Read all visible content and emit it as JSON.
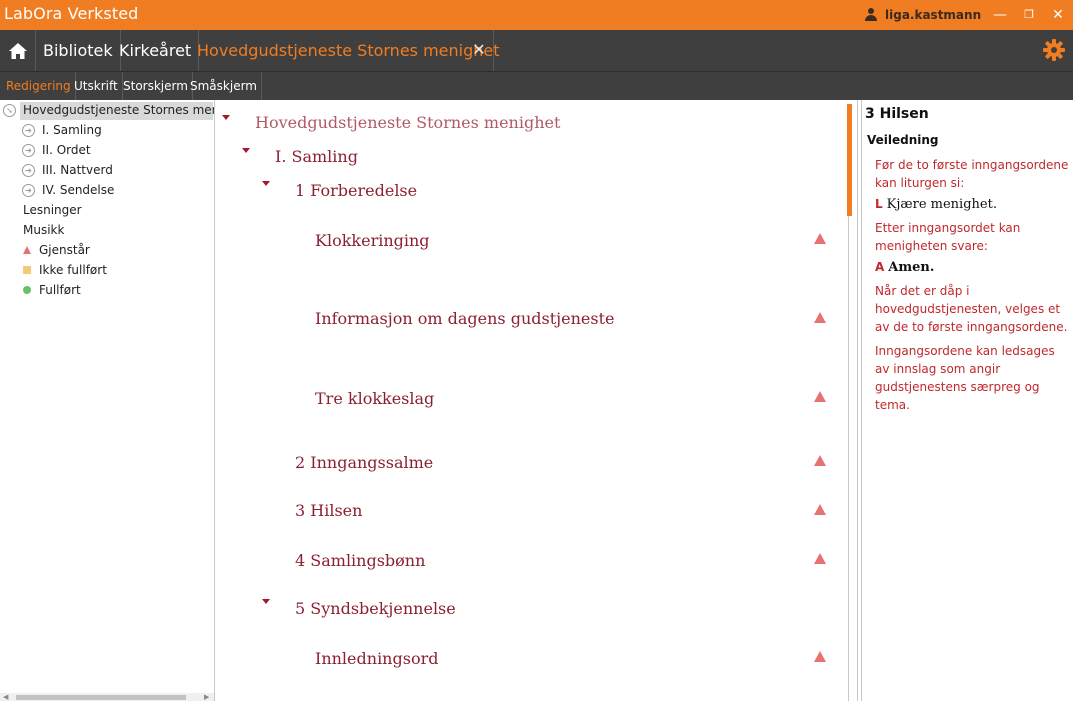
{
  "app": {
    "title": "LabOra Verksted",
    "user": "liga.kastmann",
    "window_controls": [
      "—",
      "❐",
      "✕"
    ]
  },
  "nav": {
    "items": [
      "Bibliotek",
      "Kirkeåret",
      "Hovedgudstjeneste Stornes menighet"
    ],
    "close_symbol": "✕"
  },
  "subtabs": [
    "Redigering",
    "Utskrift",
    "Storskjerm",
    "Småskjerm"
  ],
  "tree": {
    "root": "Hovedgudstjeneste Stornes menighet",
    "parts": [
      "I. Samling",
      "II. Ordet",
      "III. Nattverd",
      "IV. Sendelse"
    ],
    "extras": [
      "Lesninger",
      "Musikk"
    ],
    "legend": [
      "Gjenstår",
      "Ikke fullført",
      "Fullført"
    ]
  },
  "document": {
    "root": "Hovedgudstjeneste Stornes menighet",
    "part": "I. Samling",
    "items": [
      "1 Forberedelse",
      "Klokkeringing",
      "Informasjon om dagens gudstjeneste",
      "Tre klokkeslag",
      "2 Inngangssalme",
      "3 Hilsen",
      "4 Samlingsbønn",
      "5 Syndsbekjennelse",
      "Innledningsord"
    ]
  },
  "guidance": {
    "title": "3 Hilsen",
    "subtitle": "Veiledning",
    "p1": "Før de to første inngangsordene kan liturgen si:",
    "l1_mark": "L",
    "l1_text": "Kjære menighet.",
    "p2": "Etter inngangsordet kan menigheten svare:",
    "l2_mark": "A",
    "l2_text": "Amen.",
    "p3": "Når det er dåp i hovedgudstjenesten, velges et av de to første inngangsordene.",
    "p4": "Inngangsordene kan ledsages av innslag som angir gudstjenestens særpreg og tema."
  },
  "colors": {
    "accent": "#f07d22",
    "dark_bar": "#3f3f3f",
    "doc_text": "#8b2030",
    "guidance_text": "#c0282d",
    "remaining": "#e57373",
    "incomplete": "#f5c97a",
    "complete": "#6abf69"
  }
}
